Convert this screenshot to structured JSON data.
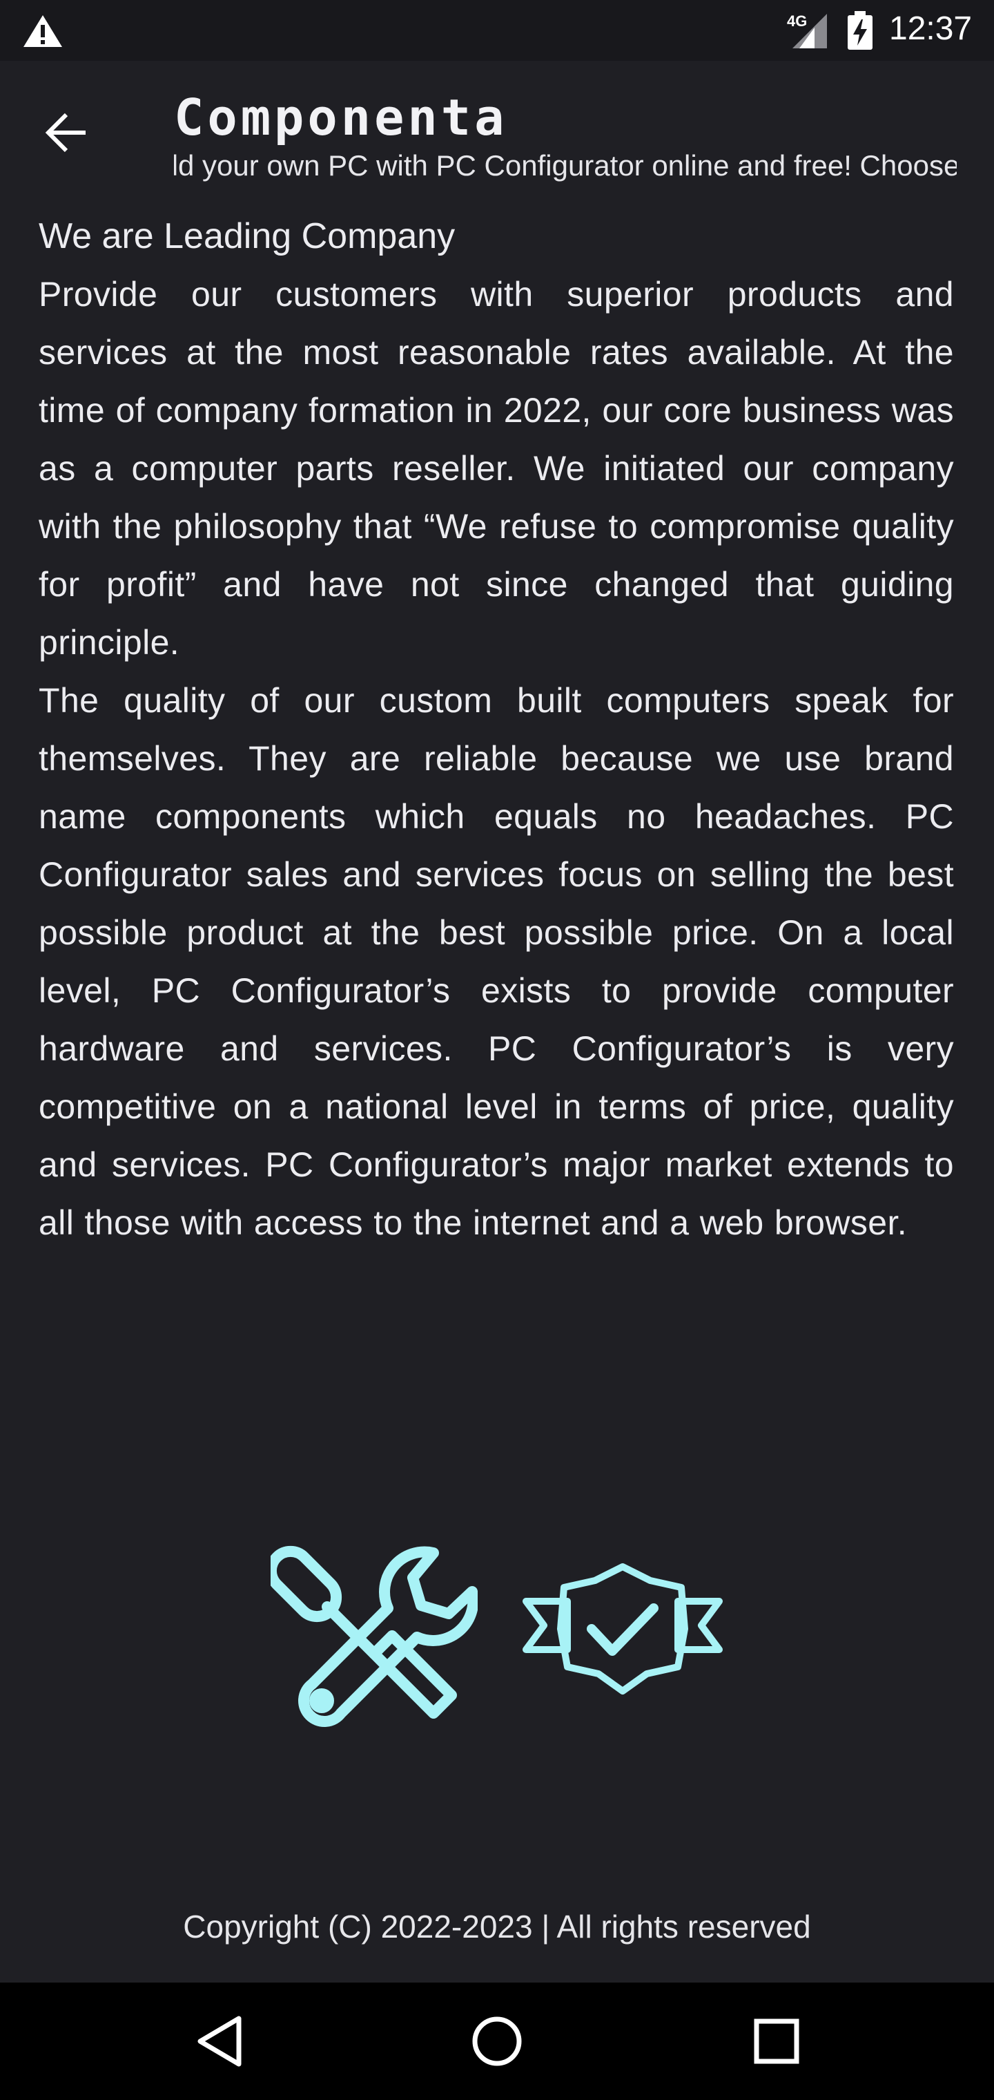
{
  "status_bar": {
    "time": "12:37",
    "network": "4G",
    "icons": [
      "warning-icon",
      "signal-icon",
      "battery-charging-icon"
    ]
  },
  "app_bar": {
    "title": "Componenta",
    "subtitle_marquee": "Build your own PC with PC Configurator online and free! Choose a",
    "back_icon": "arrow-left-icon"
  },
  "content": {
    "heading": "We are Leading Company",
    "paragraphs": [
      "Provide our customers with superior products and services at the most reasonable rates available. At the time of company formation in 2022, our core business was as a computer parts reseller. We initiated our company with the philosophy that “We refuse to compromise quality for profit” and have not since changed that guiding principle.",
      "The quality of our custom built computers speak for themselves. They are reliable because we use brand name components which equals no headaches. PC Configurator sales and services focus on selling the best possible product at the best possible price. On a local level, PC Configurator’s exists to provide computer hardware and services. PC Configurator’s is very competitive on a national level in terms of price, quality and services. PC Configurator’s major market extends to all those with access to the internet and a web browser."
    ]
  },
  "decorations": {
    "icons": [
      "tools-icon",
      "quality-badge-icon"
    ],
    "accent_color": "#a8f2f6"
  },
  "footer": {
    "copyright": "Copyright (C) 2022-2023 | All rights reserved"
  },
  "nav_bar": {
    "buttons": [
      "back-triangle-icon",
      "home-circle-icon",
      "recents-square-icon"
    ]
  }
}
